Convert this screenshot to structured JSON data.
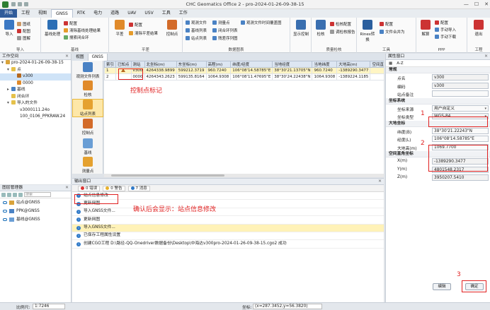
{
  "app": {
    "title": "CHC Geomatics Office 2 - pro-2024-01-26-09-38-15"
  },
  "menu": [
    "开始",
    "工程",
    "视图",
    "GNSS",
    "RTK",
    "电力",
    "道路",
    "UAV",
    "USV",
    "工具",
    "工作"
  ],
  "ribbon": {
    "import": {
      "big": "导入",
      "items": [
        "图纸",
        "配图",
        "图解",
        "导出"
      ],
      "label": "导入"
    },
    "baseline": {
      "big1": "基线处理",
      "items": [
        "配置",
        "网图处理",
        "重新计算"
      ],
      "items2": [
        "配置",
        "清除基线处理结果",
        "搜索闭合环"
      ],
      "label": "基线"
    },
    "adjust": {
      "big1": "平差",
      "items": [
        "配置",
        "清除平差结果"
      ],
      "big2": "控制点",
      "label": "平差"
    },
    "dataview": {
      "items": [
        "观测文件",
        "基线列表",
        "站点列表",
        "测量点",
        "闭合环列表",
        "残差序列图",
        "观测文件时间覆盖图"
      ],
      "label": "数据图表"
    },
    "display": {
      "big": "显示控制",
      "label": ""
    },
    "qc": {
      "big": "检核",
      "items": [
        "检核配置",
        "调检核报告"
      ],
      "label": "质量检核"
    },
    "rinex": {
      "big": "Rinex转换",
      "items": [
        "配置",
        "文件合并为"
      ],
      "label": "工具"
    },
    "ppp": {
      "big": "解算",
      "items": [
        "配置",
        "手动导入",
        "手动下载"
      ],
      "label": "PPP"
    },
    "project": {
      "big": "退出",
      "label": "工程"
    }
  },
  "workspace": {
    "title": "工作空间",
    "tree": [
      {
        "label": "pro-2024-01-26-09-38-15",
        "level": 0,
        "toggle": "▾"
      },
      {
        "label": "点",
        "level": 1,
        "toggle": "▾"
      },
      {
        "label": "v300",
        "level": 2,
        "toggle": ""
      },
      {
        "label": "0000",
        "level": 2,
        "toggle": ""
      },
      {
        "label": "基线",
        "level": 1,
        "toggle": "▸"
      },
      {
        "label": "闭合环",
        "level": 1,
        "toggle": ""
      },
      {
        "label": "导入的文件",
        "level": 1,
        "toggle": "▾"
      },
      {
        "label": "v3000111.24o",
        "level": 2,
        "toggle": ""
      },
      {
        "label": "100_0106_PPKRAW.24",
        "level": 2,
        "toggle": ""
      }
    ]
  },
  "layers": {
    "title": "图层管理器",
    "search_placeholder": "搜索",
    "items": [
      "站点@GNSS",
      "PPK@GNSS",
      "基线@GNSS"
    ]
  },
  "doc_tabs": [
    "视图",
    "GNSS"
  ],
  "gnss_sidebar": [
    "观测文件列表",
    "检核",
    "站点列表",
    "控制点",
    "基线",
    "测量点"
  ],
  "points_table": {
    "headers": [
      "索引",
      "已知点",
      "测站",
      "北坐标(m)",
      "东坐标(m)",
      "高程(m)",
      "纬度/经度",
      "当地经度",
      "当地纬度",
      "大地高(m)",
      "空间直角"
    ],
    "rows": [
      [
        "1",
        "▲",
        "v300",
        "4264338.9899",
        "599212.3719",
        "960.7240",
        "106°08'14.58785\"E",
        "38°30'21.13705\"N",
        "960.7240",
        "-1389290.3477",
        ""
      ],
      [
        "2",
        "",
        "0000",
        "4264343.2623",
        "599135.8164",
        "1064.9308",
        "106°08'11.47695\"E",
        "38°30'24.22438\"N",
        "1064.9308",
        "-1389224.1185",
        ""
      ]
    ]
  },
  "annotations": {
    "control_mark": "控制点标记",
    "confirm_msg": "确认后会显示：站点信息修改",
    "step1": "1",
    "step2": "2",
    "step3": "3"
  },
  "output": {
    "title": "输出窗口",
    "filters": {
      "error": "0 错误",
      "warning": "0 警告",
      "info": "7 消息"
    },
    "messages": [
      "站点信息修改",
      "更新网图",
      "导入GNSS文件...",
      "更新网图",
      "导入GNSS文件...",
      "已保存工程属性设置",
      "创建CGO工程 D:\\路径-QQ-Onedriver数据备份\\Desktop\\中海达v300pro-2024-01-26-09-38-15.cgo2 成功"
    ]
  },
  "props": {
    "title": "属性窗口",
    "sort": "A-Z",
    "sections": {
      "general": "常规",
      "coordsys": "坐标系统",
      "geodetic": "大地坐标",
      "cartesian": "空间直角坐标"
    },
    "general": {
      "name_label": "点名",
      "name_value": "v300",
      "code_label": "编码",
      "code_value": "v300",
      "note_label": "站点备注",
      "note_value": ""
    },
    "coordsys": {
      "source_label": "坐标来源",
      "source_value": "用户自定义",
      "type_label": "坐标类型",
      "type_value": "WGS-84"
    },
    "geodetic": {
      "lat_label": "纬度(B)",
      "lat_value": "38°30'21.22243\"N",
      "lon_label": "经度(L)",
      "lon_value": "106°08'14.58785\"E",
      "h_label": "大地高(m)",
      "h_value": "1069.7700"
    },
    "cartesian": {
      "x_label": "X(m)",
      "x_value": "-1389290.3477",
      "y_label": "Y(m)",
      "y_value": "4801548.2317",
      "z_label": "Z(m)",
      "z_value": "3950207.5410"
    },
    "edit_button": "编辑",
    "ok_button": "确定"
  },
  "status": {
    "scale_label": "比例尺:",
    "scale_value": "1:7246",
    "coord_label": "坐标:",
    "coord_value": "(x=287.3452,y=56.3820)"
  }
}
